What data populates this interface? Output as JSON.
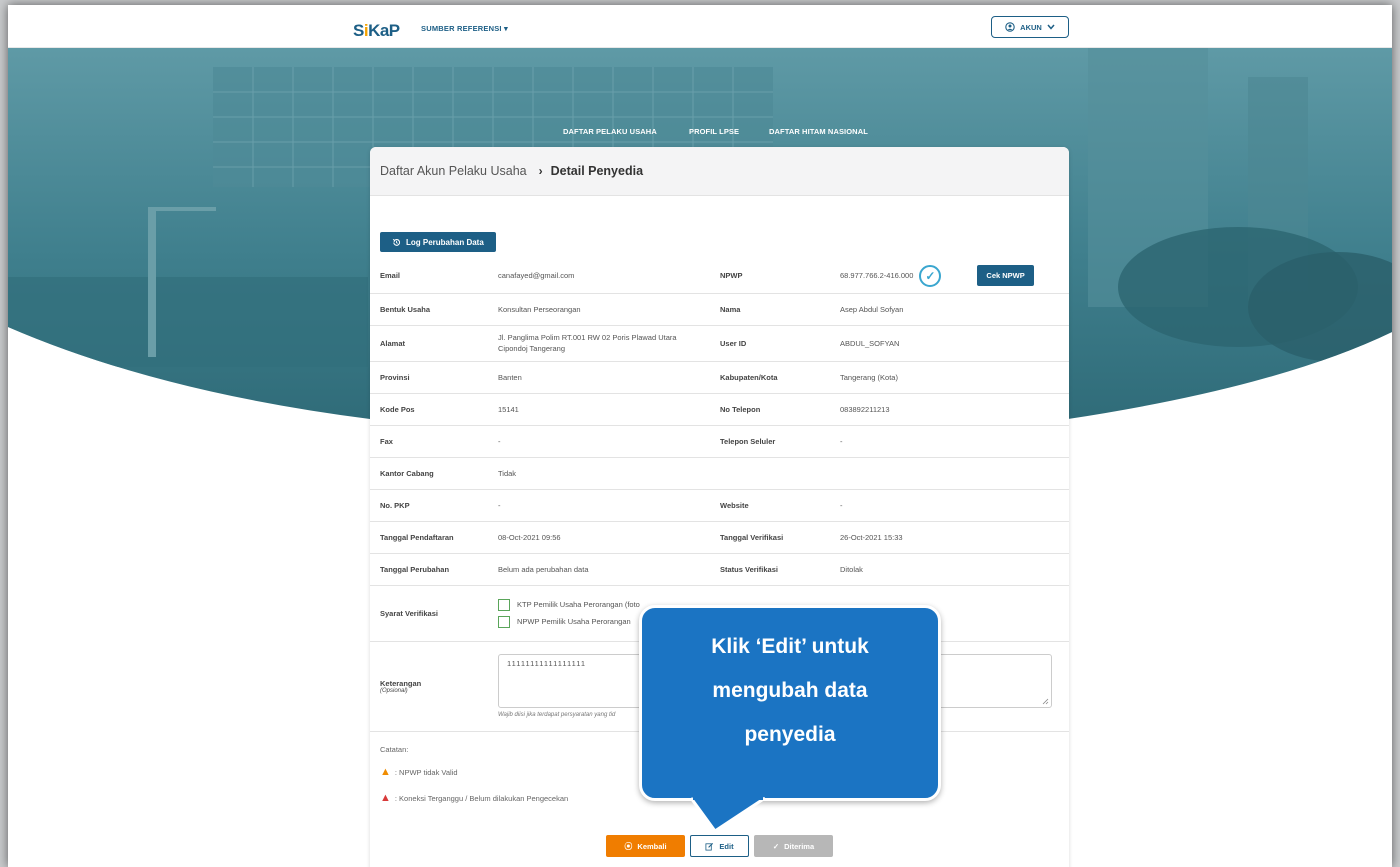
{
  "topbar": {
    "logo_s": "S",
    "logo_i": "i",
    "logo_kap": "KaP",
    "menu_ref": "SUMBER REFERENSI",
    "account": "AKUN"
  },
  "hero_menu": [
    "DAFTAR PELAKU USAHA",
    "PROFIL LPSE",
    "DAFTAR HITAM NASIONAL"
  ],
  "breadcrumb": {
    "parent": "Daftar Akun Pelaku Usaha",
    "current": "Detail Penyedia"
  },
  "log_button": "Log Perubahan Data",
  "fields": {
    "email_label": "Email",
    "email": "canafayed@gmail.com",
    "npwp_label": "NPWP",
    "npwp": "68.977.766.2-416.000",
    "cek_npwp": "Cek NPWP",
    "bentuk_label": "Bentuk Usaha",
    "bentuk": "Konsultan Perseorangan",
    "nama_label": "Nama",
    "nama": "Asep Abdul Sofyan",
    "alamat_label": "Alamat",
    "alamat": "Jl. Panglima Polim RT.001 RW 02 Poris Plawad Utara Cipondoj Tangerang",
    "userid_label": "User ID",
    "userid": "ABDUL_SOFYAN",
    "provinsi_label": "Provinsi",
    "provinsi": "Banten",
    "kab_label": "Kabupaten/Kota",
    "kab": "Tangerang (Kota)",
    "kodepos_label": "Kode Pos",
    "kodepos": "15141",
    "telp_label": "No Telepon",
    "telp": "083892211213",
    "fax_label": "Fax",
    "fax": "-",
    "seluler_label": "Telepon Seluler",
    "seluler": "-",
    "cabang_label": "Kantor Cabang",
    "cabang": "Tidak",
    "pkp_label": "No. PKP",
    "pkp": "-",
    "website_label": "Website",
    "website": "-",
    "daftar_label": "Tanggal Pendaftaran",
    "daftar": "08-Oct-2021 09:56",
    "verif_label": "Tanggal Verifikasi",
    "verif": "26-Oct-2021 15:33",
    "ubah_label": "Tanggal Perubahan",
    "ubah": "Belum ada perubahan data",
    "status_label": "Status Verifikasi",
    "status": "Ditolak",
    "syarat_label": "Syarat Verifikasi",
    "syarat_1": "KTP Pemilik Usaha Perorangan (foto",
    "syarat_2": "NPWP Pemilik Usaha Perorangan",
    "ket_label": "Keterangan",
    "ket_sub": "(Opsional)",
    "ket_value": "11111111111111111",
    "ket_help": "Wajib diisi jika terdapat persyaratan yang tid"
  },
  "notes": {
    "title": "Catatan:",
    "n1": ": NPWP tidak Valid",
    "n2": ": Koneksi Terganggu / Belum dilakukan Pengecekan"
  },
  "buttons": {
    "kembali": "Kembali",
    "edit": "Edit",
    "diterima": "Diterima"
  },
  "callout": {
    "line1": "Klik ‘Edit’ untuk",
    "line2": "mengubah data",
    "line3": "penyedia"
  },
  "colors": {
    "primary": "#1d5f86",
    "accent": "#f07d00",
    "callout": "#1b74c3"
  }
}
